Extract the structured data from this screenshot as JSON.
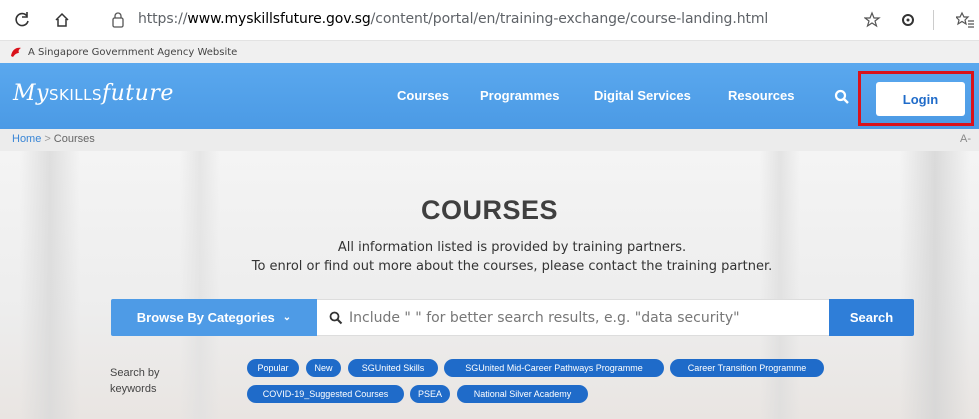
{
  "browser": {
    "url_scheme": "https://",
    "url_host": "www.myskillsfuture.gov.sg",
    "url_path": "/content/portal/en/training-exchange/course-landing.html"
  },
  "gov_bar": {
    "text": "A Singapore Government Agency Website"
  },
  "header": {
    "logo_my": "My",
    "logo_skills": "SKILLS",
    "logo_future": "future",
    "nav": [
      "Courses",
      "Programmes",
      "Digital Services",
      "Resources"
    ],
    "login_label": "Login",
    "brand_color": "#4f9fe8"
  },
  "breadcrumb": {
    "home": "Home",
    "separator": ">",
    "current": "Courses",
    "font_toggle": "A-"
  },
  "hero": {
    "title": "COURSES",
    "line1": "All information listed is provided by training partners.",
    "line2": "To enrol or find out more about the courses, please contact the training partner."
  },
  "search": {
    "category_label": "Browse By Categories",
    "placeholder": "Include \" \" for better search results, e.g. \"data security\"",
    "button_label": "Search"
  },
  "keywords": {
    "label_line1": "Search by",
    "label_line2": "keywords",
    "chips": [
      "Popular",
      "New",
      "SGUnited Skills",
      "SGUnited Mid-Career Pathways Programme",
      "Career Transition Programme",
      "COVID-19_Suggested Courses",
      "PSEA",
      "National Silver Academy"
    ]
  }
}
